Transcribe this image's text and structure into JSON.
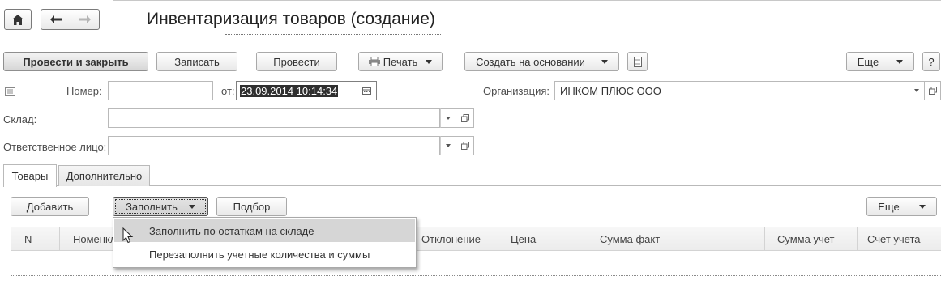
{
  "nav": {
    "home_icon": "home-icon",
    "back_icon": "arrow-left-icon",
    "forward_icon": "arrow-right-icon"
  },
  "header": {
    "title": "Инвентаризация товаров (создание)"
  },
  "toolbar": {
    "post_close": "Провести и закрыть",
    "save": "Записать",
    "post": "Провести",
    "print": "Печать",
    "create_based": "Создать на основании",
    "more": "Еще",
    "help": "?"
  },
  "form": {
    "number_label": "Номер:",
    "number_value": "",
    "date_label": "от:",
    "date_value": "23.09.2014 10:14:34",
    "org_label": "Организация:",
    "org_value": "ИНКОМ ПЛЮС ООО",
    "warehouse_label": "Склад:",
    "warehouse_value": "",
    "responsible_label": "Ответственное лицо:",
    "responsible_value": ""
  },
  "tabs": [
    {
      "label": "Товары",
      "active": true
    },
    {
      "label": "Дополнительно",
      "active": false
    }
  ],
  "table_toolbar": {
    "add": "Добавить",
    "fill": "Заполнить",
    "select": "Подбор",
    "more": "Еще"
  },
  "table": {
    "columns": [
      "N",
      "Номенклатура",
      "Отклонение",
      "Цена",
      "Сумма факт",
      "Сумма учет",
      "Счет учета"
    ]
  },
  "fill_menu": {
    "items": [
      {
        "label": "Заполнить по остаткам на складе",
        "highlighted": true
      },
      {
        "label": "Перезаполнить учетные количества и суммы",
        "highlighted": false
      }
    ]
  },
  "colors": {
    "menu_highlight": "#d6d6d6",
    "date_selection": "#2f2f2f",
    "field_border": "#b9b9b9"
  }
}
